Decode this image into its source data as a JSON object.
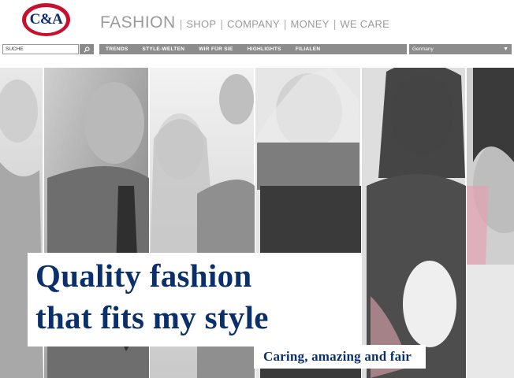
{
  "brand": {
    "logo_text": "C&A",
    "logo_color": "#c8102e",
    "text_color": "#0b2f6b"
  },
  "topnav": {
    "items": [
      "FASHION",
      "SHOP",
      "COMPANY",
      "MONEY",
      "WE CARE"
    ],
    "separator": "|"
  },
  "search": {
    "value": "SUCHE",
    "button_icon": "search-icon"
  },
  "menubar": {
    "items": [
      "TRENDS",
      "STYLE-WELTEN",
      "WIR FÜR SIE",
      "HIGHLIGHTS",
      "FILIALEN"
    ]
  },
  "country": {
    "selected": "Germany",
    "icon": "chevron-down-icon"
  },
  "hero": {
    "headline_line1": "Quality fashion",
    "headline_line2": "that fits my style",
    "tagline": "Caring, amazing and fair"
  }
}
